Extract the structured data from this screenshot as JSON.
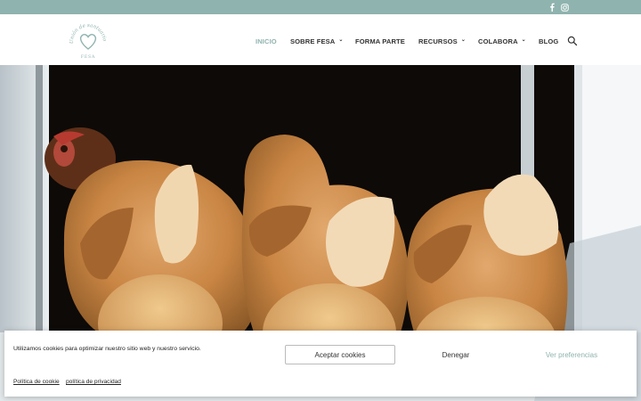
{
  "colors": {
    "accent": "#8fb3ae",
    "text": "#333333",
    "topbar": "#8fb3ae"
  },
  "topbar": {
    "social": [
      {
        "icon": "facebook-icon"
      },
      {
        "icon": "instagram-icon"
      }
    ]
  },
  "logo": {
    "arc_text": "Unión de santuarios",
    "bottom_text": "FESA"
  },
  "nav": {
    "items": [
      {
        "label": "INICIO",
        "active": true
      },
      {
        "label": "SOBRE FESA",
        "dropdown": true
      },
      {
        "label": "FORMA PARTE"
      },
      {
        "label": "RECURSOS",
        "dropdown": true
      },
      {
        "label": "COLABORA",
        "dropdown": true
      },
      {
        "label": "BLOG"
      }
    ],
    "search_icon": "search-icon"
  },
  "cookie_banner": {
    "message": "Utilizamos cookies para optimizar nuestro sitio web y nuestro servicio.",
    "accept_label": "Aceptar cookies",
    "deny_label": "Denegar",
    "preferences_label": "Ver preferencias",
    "cookie_policy_link": "Política de cookie",
    "privacy_policy_link": "política de privacidad"
  }
}
